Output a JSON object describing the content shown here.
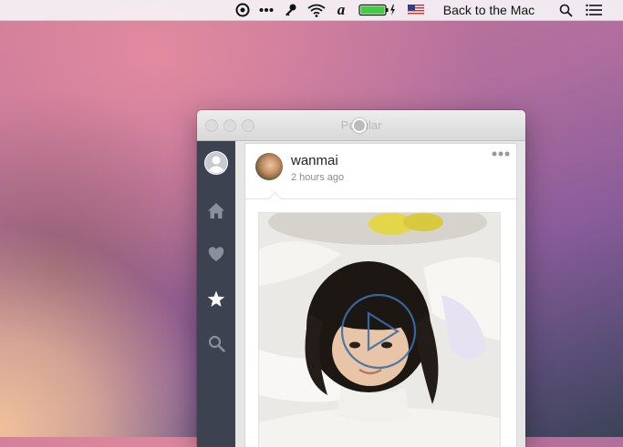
{
  "menubar": {
    "status_items": [
      "target-icon",
      "more-dots-icon",
      "key-icon",
      "wifi-icon",
      "a-icon",
      "battery-icon",
      "us-flag-icon"
    ],
    "user_label": "Back to the Mac",
    "right_icons": [
      "spotlight-search-icon",
      "notification-center-icon"
    ]
  },
  "window": {
    "title": "Popular"
  },
  "sidebar": {
    "items": [
      {
        "name": "profile",
        "icon": "user-icon",
        "active": false
      },
      {
        "name": "home",
        "icon": "home-icon",
        "active": false
      },
      {
        "name": "likes",
        "icon": "heart-icon",
        "active": false
      },
      {
        "name": "popular",
        "icon": "star-icon",
        "active": true
      },
      {
        "name": "search",
        "icon": "search-icon",
        "active": false
      }
    ]
  },
  "post": {
    "username": "wanmai",
    "timestamp": "2 hours ago",
    "media_type": "video"
  },
  "colors": {
    "sidebar_bg": "#3d4250",
    "icon_inactive": "#8a8f99",
    "icon_active": "#ffffff",
    "play_button": "#3a6fa8"
  }
}
